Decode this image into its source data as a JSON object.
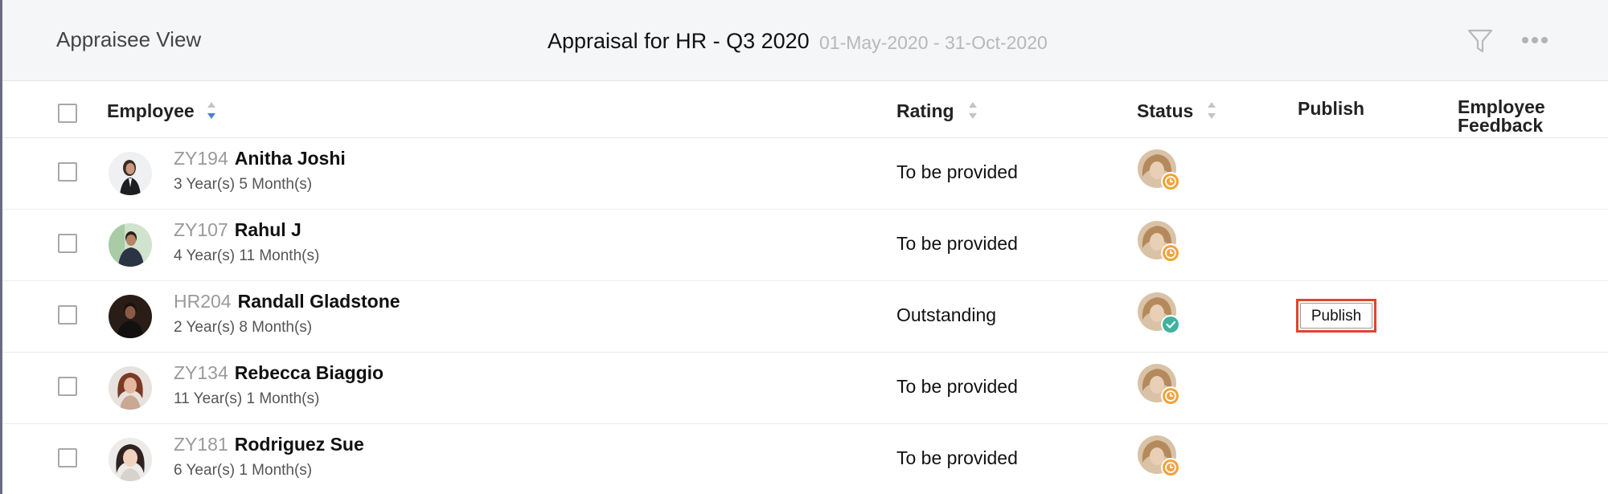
{
  "header": {
    "view_title": "Appraisee View",
    "title": "Appraisal for HR - Q3 2020",
    "date_range": "01-May-2020 - 31-Oct-2020",
    "filter_icon": "filter-icon",
    "more_icon": "more-horizontal-icon"
  },
  "columns": {
    "employee": "Employee",
    "rating": "Rating",
    "status": "Status",
    "publish": "Publish",
    "feedback_line1": "Employee",
    "feedback_line2": "Feedback"
  },
  "colors": {
    "accent_sort": "#4a7fd6",
    "pending_badge": "#f0a43c",
    "done_badge": "#3db39e",
    "publish_highlight": "#e2452b"
  },
  "rows": [
    {
      "id": "ZY194",
      "name": "Anitha Joshi",
      "tenure": "3 Year(s) 5 Month(s)",
      "rating": "To be provided",
      "status": "pending"
    },
    {
      "id": "ZY107",
      "name": "Rahul J",
      "tenure": "4 Year(s) 11 Month(s)",
      "rating": "To be provided",
      "status": "pending"
    },
    {
      "id": "HR204",
      "name": "Randall Gladstone",
      "tenure": "2 Year(s) 8 Month(s)",
      "rating": "Outstanding",
      "status": "completed",
      "publish_label": "Publish"
    },
    {
      "id": "ZY134",
      "name": "Rebecca Biaggio",
      "tenure": "11 Year(s) 1 Month(s)",
      "rating": "To be provided",
      "status": "pending"
    },
    {
      "id": "ZY181",
      "name": "Rodriguez Sue",
      "tenure": "6 Year(s) 1 Month(s)",
      "rating": "To be provided",
      "status": "pending"
    }
  ]
}
